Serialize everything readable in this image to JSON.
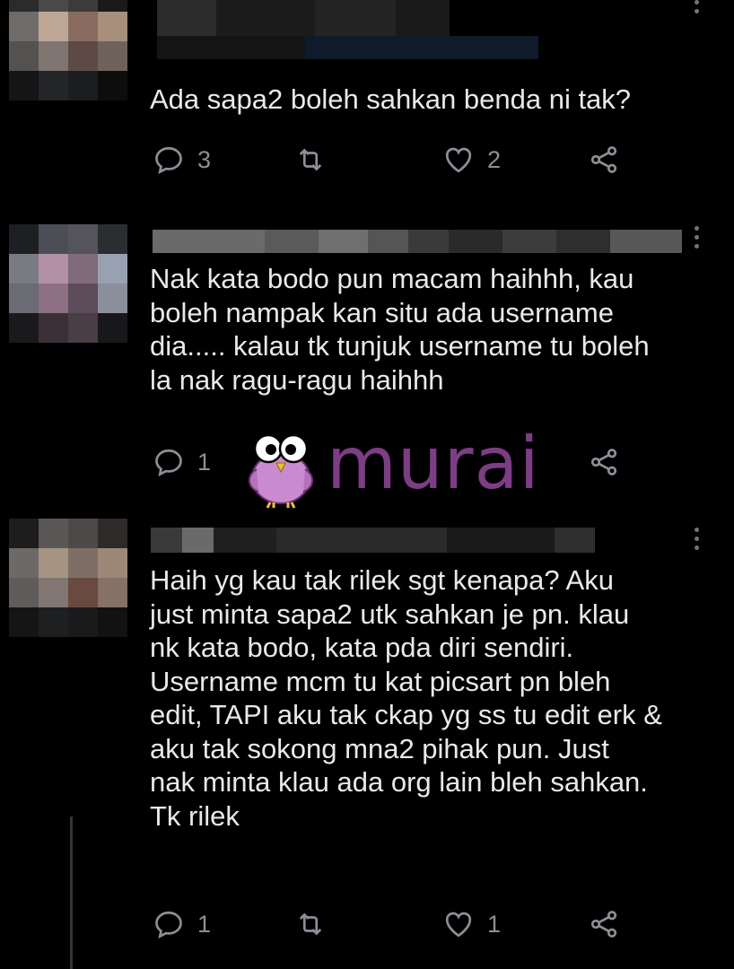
{
  "tweets": [
    {
      "text": "Ada sapa2 boleh sahkan benda ni tak?",
      "replies": "3",
      "retweets": "",
      "likes": "2"
    },
    {
      "text": "Nak kata bodo pun macam haihhh, kau\nboleh nampak kan situ ada username\ndia..... kalau tk tunjuk username tu boleh\nla nak ragu-ragu haihhh",
      "replies": "1",
      "retweets": "",
      "likes": ""
    },
    {
      "text": "Haih yg kau tak rilek sgt kenapa? Aku\njust minta sapa2 utk sahkan je pn. klau\nnk kata bodo, kata pda diri sendiri.\nUsername mcm tu kat picsart pn bleh\nedit, TAPI aku tak ckap yg ss tu edit erk &\naku tak sokong mna2 pihak pun. Just\nnak minta klau ada org lain bleh sahkan.\nTk rilek",
      "replies": "1",
      "retweets": "",
      "likes": "1"
    }
  ],
  "watermark": {
    "text": "murai",
    "color": "#7e3c86",
    "icon": "owl-icon"
  },
  "colors": {
    "background": "#000000",
    "text": "#e7e9ea",
    "icon_gray": "#71767b"
  }
}
